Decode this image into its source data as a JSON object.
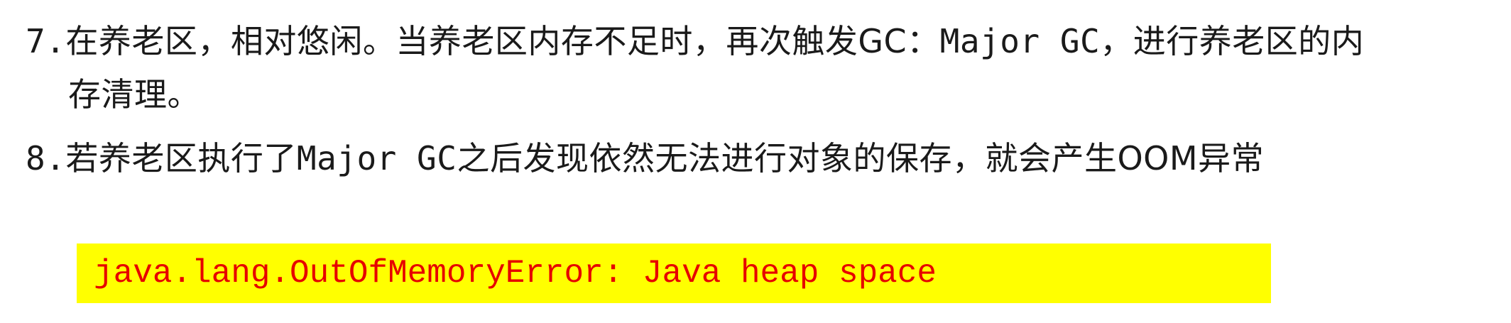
{
  "items": [
    {
      "number": "7.",
      "text_a": "在养老区，相对悠闲。当养老区内存不足时，再次触发",
      "text_b": "GC：",
      "text_c": "Major GC",
      "text_d": "，进行养老区的内",
      "continuation": "存清理。"
    },
    {
      "number": "8.",
      "text_a": "若养老区执行了",
      "text_b": "Major GC",
      "text_c": "之后发现依然无法进行对象的保存，就会产生",
      "text_d": "OOM",
      "text_e": "异常"
    }
  ],
  "code": {
    "text": "java.lang.OutOfMemoryError: Java heap space"
  }
}
